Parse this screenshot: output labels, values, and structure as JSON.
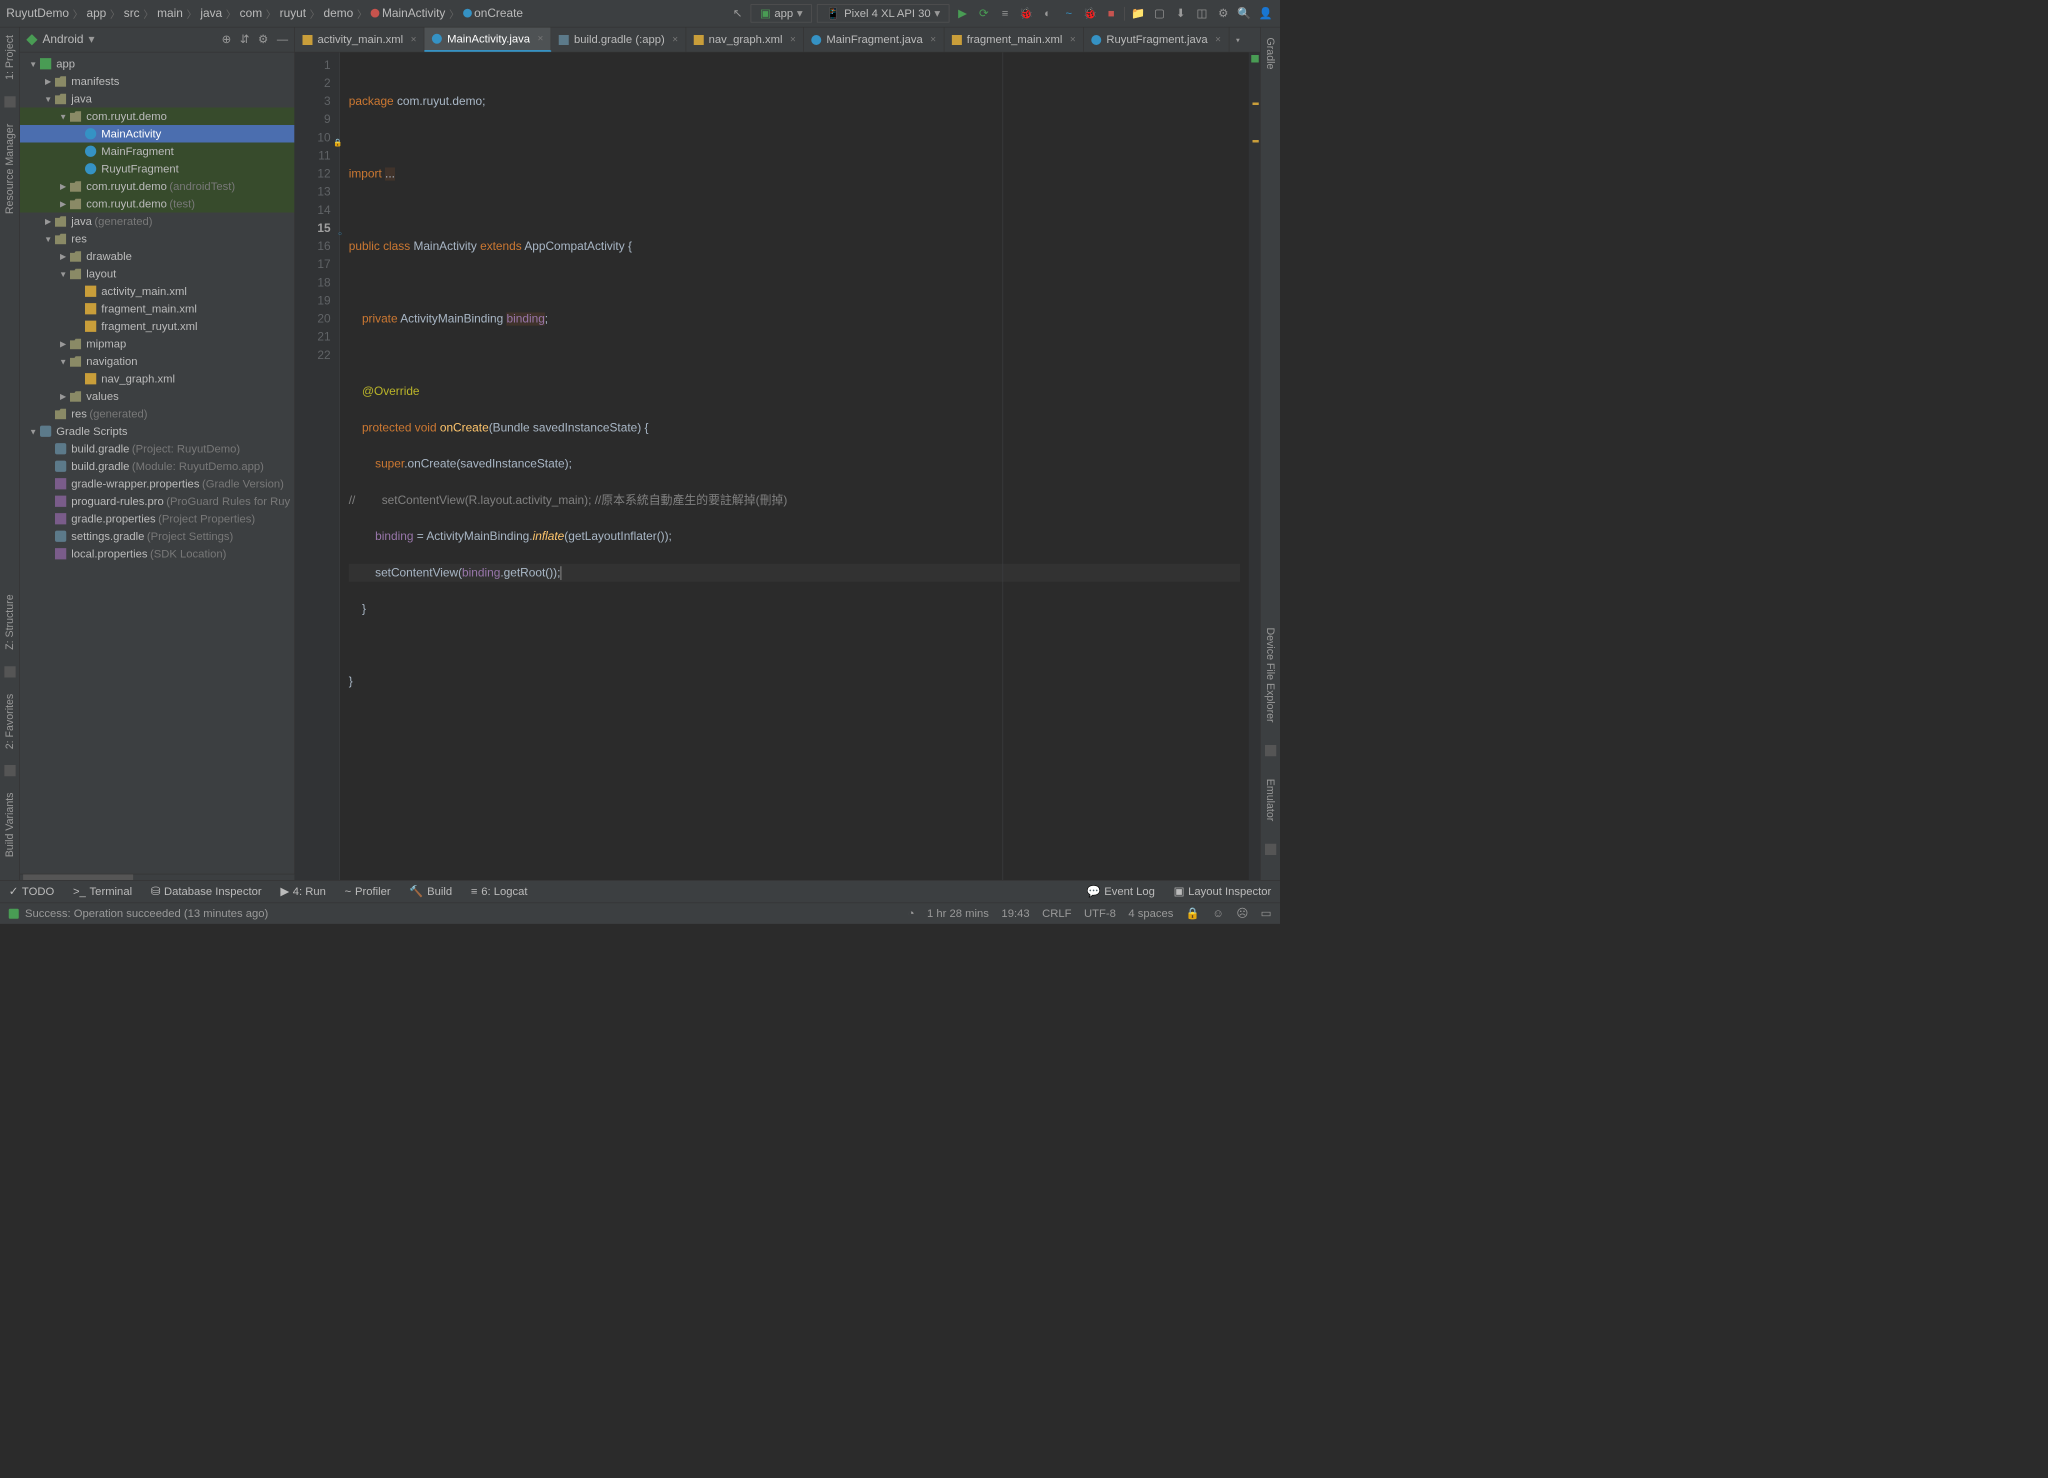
{
  "breadcrumb": [
    "RuyutDemo",
    "app",
    "src",
    "main",
    "java",
    "com",
    "ruyut",
    "demo",
    "MainActivity",
    "onCreate"
  ],
  "run_config": {
    "app_label": "app",
    "device_label": "Pixel 4 XL API 30"
  },
  "project_panel": {
    "title": "Android",
    "tree": [
      {
        "d": 0,
        "a": "open",
        "i": "module",
        "t": "app"
      },
      {
        "d": 1,
        "a": "closed",
        "i": "folder",
        "t": "manifests"
      },
      {
        "d": 1,
        "a": "open",
        "i": "folder",
        "t": "java"
      },
      {
        "d": 2,
        "a": "open",
        "i": "pkg",
        "t": "com.ruyut.demo",
        "hl": true
      },
      {
        "d": 3,
        "a": "none",
        "i": "class",
        "t": "MainActivity",
        "sel": true
      },
      {
        "d": 3,
        "a": "none",
        "i": "class",
        "t": "MainFragment",
        "hl": true
      },
      {
        "d": 3,
        "a": "none",
        "i": "class",
        "t": "RuyutFragment",
        "hl": true
      },
      {
        "d": 2,
        "a": "closed",
        "i": "pkg",
        "t": "com.ruyut.demo",
        "dim": "(androidTest)",
        "hl": true
      },
      {
        "d": 2,
        "a": "closed",
        "i": "pkg",
        "t": "com.ruyut.demo",
        "dim": "(test)",
        "hl": true
      },
      {
        "d": 1,
        "a": "closed",
        "i": "folder",
        "t": "java",
        "dim": "(generated)"
      },
      {
        "d": 1,
        "a": "open",
        "i": "folder",
        "t": "res"
      },
      {
        "d": 2,
        "a": "closed",
        "i": "folder",
        "t": "drawable"
      },
      {
        "d": 2,
        "a": "open",
        "i": "folder",
        "t": "layout"
      },
      {
        "d": 3,
        "a": "none",
        "i": "xml",
        "t": "activity_main.xml"
      },
      {
        "d": 3,
        "a": "none",
        "i": "xml",
        "t": "fragment_main.xml"
      },
      {
        "d": 3,
        "a": "none",
        "i": "xml",
        "t": "fragment_ruyut.xml"
      },
      {
        "d": 2,
        "a": "closed",
        "i": "folder",
        "t": "mipmap"
      },
      {
        "d": 2,
        "a": "open",
        "i": "folder",
        "t": "navigation"
      },
      {
        "d": 3,
        "a": "none",
        "i": "xml",
        "t": "nav_graph.xml"
      },
      {
        "d": 2,
        "a": "closed",
        "i": "folder",
        "t": "values"
      },
      {
        "d": 1,
        "a": "none",
        "i": "folder",
        "t": "res",
        "dim": "(generated)"
      },
      {
        "d": 0,
        "a": "open",
        "i": "gradle",
        "t": "Gradle Scripts"
      },
      {
        "d": 1,
        "a": "none",
        "i": "gradle",
        "t": "build.gradle",
        "dim": "(Project: RuyutDemo)"
      },
      {
        "d": 1,
        "a": "none",
        "i": "gradle",
        "t": "build.gradle",
        "dim": "(Module: RuyutDemo.app)"
      },
      {
        "d": 1,
        "a": "none",
        "i": "prop",
        "t": "gradle-wrapper.properties",
        "dim": "(Gradle Version)"
      },
      {
        "d": 1,
        "a": "none",
        "i": "prop",
        "t": "proguard-rules.pro",
        "dim": "(ProGuard Rules for Ruy"
      },
      {
        "d": 1,
        "a": "none",
        "i": "prop",
        "t": "gradle.properties",
        "dim": "(Project Properties)"
      },
      {
        "d": 1,
        "a": "none",
        "i": "gradle",
        "t": "settings.gradle",
        "dim": "(Project Settings)"
      },
      {
        "d": 1,
        "a": "none",
        "i": "prop",
        "t": "local.properties",
        "dim": "(SDK Location)"
      }
    ]
  },
  "tabs": [
    {
      "i": "xml",
      "t": "activity_main.xml"
    },
    {
      "i": "java",
      "t": "MainActivity.java",
      "active": true
    },
    {
      "i": "gradle",
      "t": "build.gradle (:app)"
    },
    {
      "i": "xml",
      "t": "nav_graph.xml"
    },
    {
      "i": "java",
      "t": "MainFragment.java"
    },
    {
      "i": "xml",
      "t": "fragment_main.xml"
    },
    {
      "i": "java",
      "t": "RuyutFragment.java"
    }
  ],
  "code": {
    "lines": [
      1,
      2,
      3,
      9,
      10,
      11,
      12,
      13,
      14,
      15,
      16,
      17,
      18,
      19,
      20,
      21,
      22
    ],
    "l1": "package com.ruyut.demo;",
    "l3_a": "import ",
    "l3_b": "...",
    "l10": "public class MainActivity extends AppCompatActivity {",
    "l12_a": "    private ",
    "l12_b": "ActivityMainBinding ",
    "l12_c": "binding",
    "l12_d": ";",
    "l14": "    @Override",
    "l15_a": "    protected void ",
    "l15_b": "onCreate",
    "l15_c": "(Bundle savedInstanceState) {",
    "l16_a": "        super",
    "l16_b": ".onCreate(savedInstanceState);",
    "l17_a": "//",
    "l17_b": "        setContentView(R.layout.activity_main); //原本系統自動產生的要註解掉(刪掉)",
    "l18_a": "        ",
    "l18_b": "binding",
    "l18_c": " = ActivityMainBinding.",
    "l18_d": "inflate",
    "l18_e": "(getLayoutInflater());",
    "l19_a": "        setContentView(",
    "l19_b": "binding",
    "l19_c": ".getRoot());",
    "l20": "    }",
    "l22": "}"
  },
  "left_strip": [
    "1: Project",
    "Resource Manager"
  ],
  "left_strip2": [
    "Z: Structure",
    "2: Favorites",
    "Build Variants"
  ],
  "right_strip": [
    "Gradle",
    "Device File Explorer",
    "Emulator"
  ],
  "bottom_tabs": {
    "left": [
      {
        "icon": "✓",
        "t": "TODO"
      },
      {
        "icon": ">_",
        "t": "Terminal"
      },
      {
        "icon": "⛁",
        "t": "Database Inspector"
      },
      {
        "icon": "▶",
        "t": "4: Run",
        "u": "4"
      },
      {
        "icon": "~",
        "t": "Profiler"
      },
      {
        "icon": "🔨",
        "t": "Build"
      },
      {
        "icon": "≡",
        "t": "6: Logcat",
        "u": "6"
      }
    ],
    "right": [
      {
        "icon": "💬",
        "t": "Event Log"
      },
      {
        "icon": "▣",
        "t": "Layout Inspector"
      }
    ]
  },
  "status": {
    "msg": "Success: Operation succeeded (13 minutes ago)",
    "time": "1 hr 28 mins",
    "pos": "19:43",
    "sep": "CRLF",
    "enc": "UTF-8",
    "indent": "4 spaces"
  }
}
